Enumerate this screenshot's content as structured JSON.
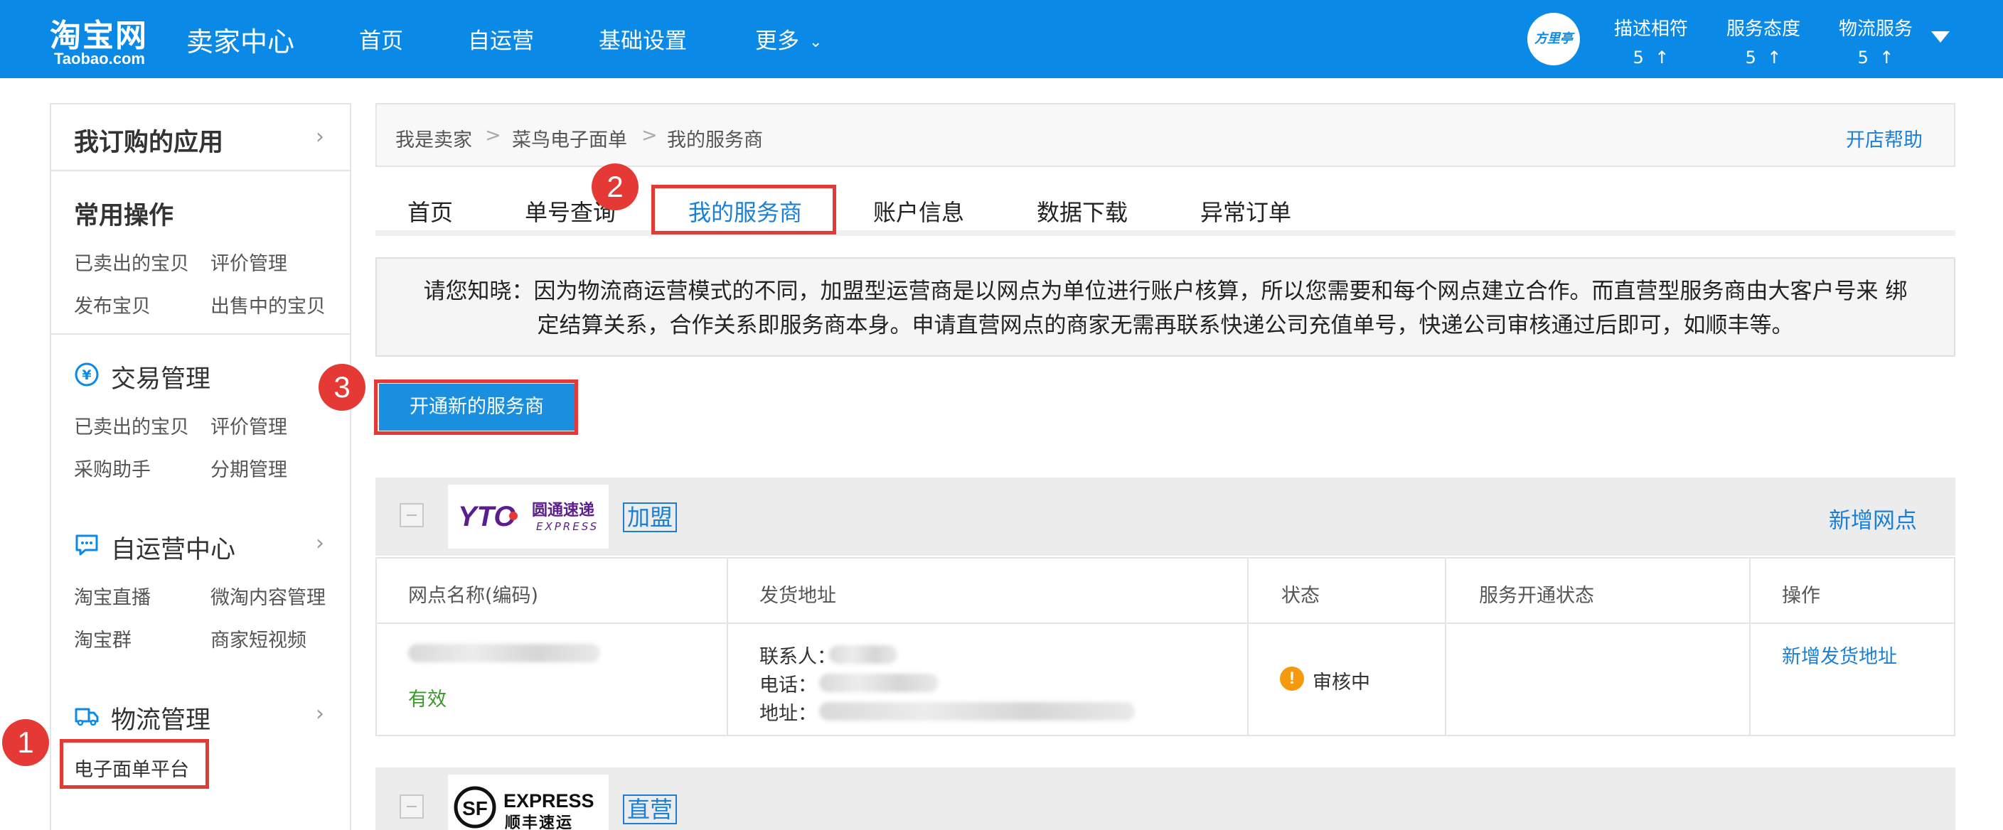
{
  "header": {
    "logo_cn": "淘宝网",
    "logo_en": "Taobao.com",
    "seller_center": "卖家中心",
    "nav": [
      "首页",
      "自运营",
      "基础设置",
      "更多"
    ],
    "avatar_text": "方里亭",
    "scores": [
      {
        "label": "描述相符",
        "value": "5",
        "trend": "↑"
      },
      {
        "label": "服务态度",
        "value": "5",
        "trend": "↑"
      },
      {
        "label": "物流服务",
        "value": "5",
        "trend": "↑"
      }
    ],
    "colors": {
      "topbar": "#0a8ae6",
      "accent": "#1a7fd6",
      "annotation": "#e53935"
    }
  },
  "sidebar": {
    "my_apps": "我订购的应用",
    "common_ops": {
      "title": "常用操作",
      "links": [
        "已卖出的宝贝",
        "评价管理",
        "发布宝贝",
        "出售中的宝贝"
      ]
    },
    "trade": {
      "title": "交易管理",
      "icon": "yen-icon",
      "links": [
        "已卖出的宝贝",
        "评价管理",
        "采购助手",
        "分期管理"
      ]
    },
    "self_ops": {
      "title": "自运营中心",
      "icon": "chat-icon",
      "links": [
        "淘宝直播",
        "微淘内容管理",
        "淘宝群",
        "商家短视频"
      ]
    },
    "logistics": {
      "title": "物流管理",
      "icon": "truck-icon",
      "links": [
        "电子面单平台"
      ]
    }
  },
  "breadcrumb": {
    "items": [
      "我是卖家",
      "菜鸟电子面单",
      "我的服务商"
    ],
    "separator": ">",
    "help": "开店帮助"
  },
  "tabs": [
    "首页",
    "单号查询",
    "我的服务商",
    "账户信息",
    "数据下载",
    "异常订单"
  ],
  "active_tab": "我的服务商",
  "notice": {
    "line1": "请您知晓：因为物流商运营模式的不同，加盟型运营商是以网点为单位进行账户核算，所以您需要和每个网点建立合作。而直营型服务商由大客户号来 绑",
    "line2": "定结算关系，合作关系即服务商本身。申请直营网点的商家无需再联系快递公司充值单号，快递公司审核通过后即可，如顺丰等。"
  },
  "open_button": "开通新的服务商",
  "annotations": [
    "1",
    "2",
    "3"
  ],
  "cards": [
    {
      "logo_mark": "YTO",
      "logo_cn": "圆通速递",
      "logo_en": "EXPRESS",
      "type": "加盟",
      "add_site": "新增网点",
      "columns": [
        "网点名称(编码)",
        "发货地址",
        "状态",
        "服务开通状态",
        "操作"
      ],
      "row": {
        "site_status": "有效",
        "contact_label": "联系人：",
        "phone_label": "电话：",
        "address_label": "地址：",
        "status": "审核中",
        "status_icon": "!",
        "action": "新增发货地址"
      }
    },
    {
      "logo_mark": "SF",
      "logo_en": "EXPRESS",
      "logo_cn": "顺丰速运",
      "type": "直营"
    }
  ]
}
